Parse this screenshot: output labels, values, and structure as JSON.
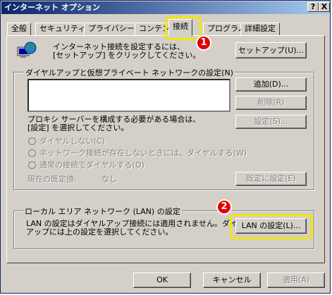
{
  "window": {
    "title": "インターネット オプション",
    "help_glyph": "?",
    "close_glyph": "X"
  },
  "tabs": [
    {
      "label": "全般"
    },
    {
      "label": "セキュリティ"
    },
    {
      "label": "プライバシー"
    },
    {
      "label": "コンテンツ"
    },
    {
      "label": "接続"
    },
    {
      "label": "プログラム"
    },
    {
      "label": "詳細設定"
    }
  ],
  "setup": {
    "text_line1": "インターネット接続を設定するには、",
    "text_line2": "[セットアップ] をクリックしてください。",
    "button": "セットアップ(U)..."
  },
  "dialup": {
    "group_label": "ダイヤルアップと仮想プライベート ネットワークの設定(N)",
    "add_button": "追加(D)...",
    "delete_button": "削除(R)",
    "settings_button": "設定(S)...",
    "proxy_line1": "プロキシ サーバーを構成する必要がある場合は、",
    "proxy_line2": "[設定] を選択してください。",
    "radio_options": [
      "ダイヤルしない(C)",
      "ネットワーク接続が存在しないときには、ダイヤルする(W)",
      "通常の接続でダイヤルする(O)"
    ],
    "current_default_label": "現在の既定値:",
    "current_default_value": "なし",
    "set_default_button": "既定に設定(E)"
  },
  "lan": {
    "group_label": "ローカル エリア ネットワーク (LAN) の設定",
    "text_line1": "LAN の設定はダイヤルアップ接続には適用されません。ダイヤル",
    "text_line2": "アップには上の設定を選択してください。",
    "button": "LAN の設定(L)..."
  },
  "footer": {
    "ok": "OK",
    "cancel": "キャンセル",
    "apply": "適用(A)"
  },
  "annotations": {
    "step1": "1",
    "step2": "2",
    "highlight_color": "#f2e800",
    "badge_color": "#e10000"
  }
}
